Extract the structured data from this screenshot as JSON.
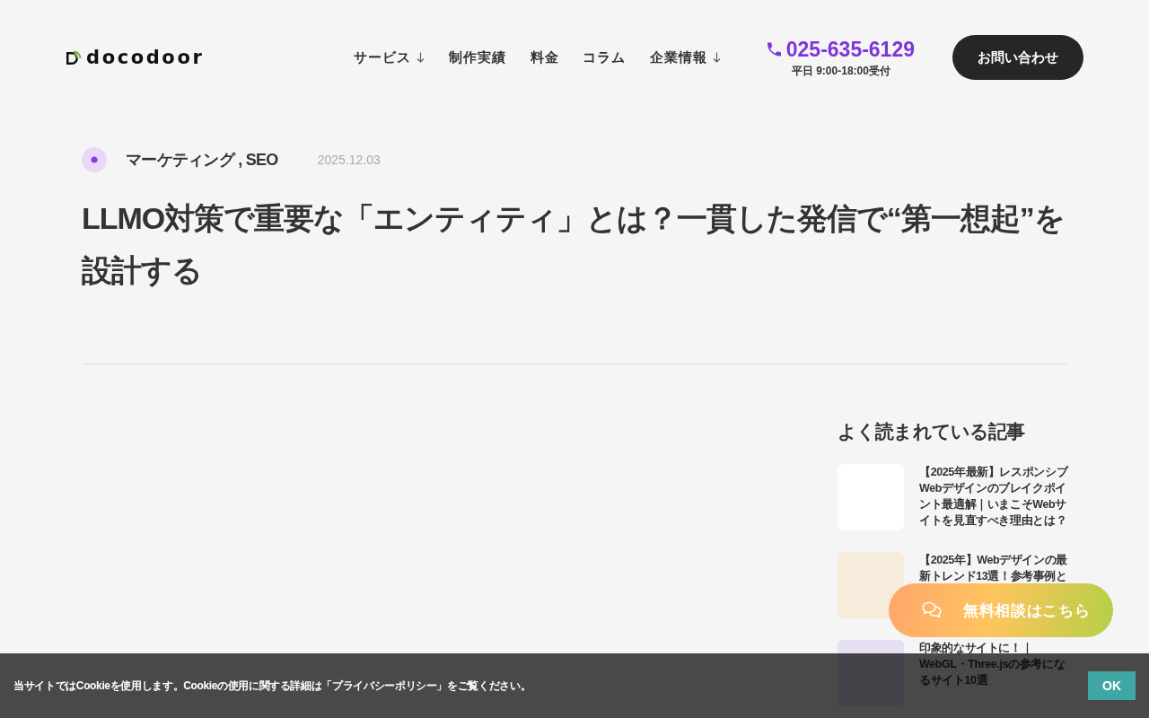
{
  "header": {
    "logo": "docodoor",
    "nav": [
      {
        "label": "サービス",
        "dropdown": true
      },
      {
        "label": "制作実績",
        "dropdown": false
      },
      {
        "label": "料金",
        "dropdown": false
      },
      {
        "label": "コラム",
        "dropdown": false
      },
      {
        "label": "企業情報",
        "dropdown": true
      }
    ],
    "phone": {
      "number": "025-635-6129",
      "hours": "平日 9:00-18:00受付"
    },
    "contact_button": "お問い合わせ"
  },
  "article": {
    "category": "マーケティング , SEO",
    "date": "2025.12.03",
    "title": "LLMO対策で重要な「エンティティ」とは？一貫した発信で“第一想起”を設計する"
  },
  "sidebar": {
    "heading": "よく読まれている記事",
    "articles": [
      {
        "title": "【2025年最新】レスポンシブWebデザインのブレイクポイント最適解｜いまこそWebサイトを見直すべき理由とは？"
      },
      {
        "title": "【2025年】Webデザインの最新トレンド13選！参考事例と"
      },
      {
        "title": "印象的なサイトに！｜WebGL・Three.jsの参考になるサイト10選"
      }
    ]
  },
  "consult_button": "無料相談はこちら",
  "cookie_banner": {
    "message": "当サイトではCookieを使用します。Cookieの使用に関する詳細は「プライバシーポリシー」をご覧ください。",
    "button": "OK"
  }
}
